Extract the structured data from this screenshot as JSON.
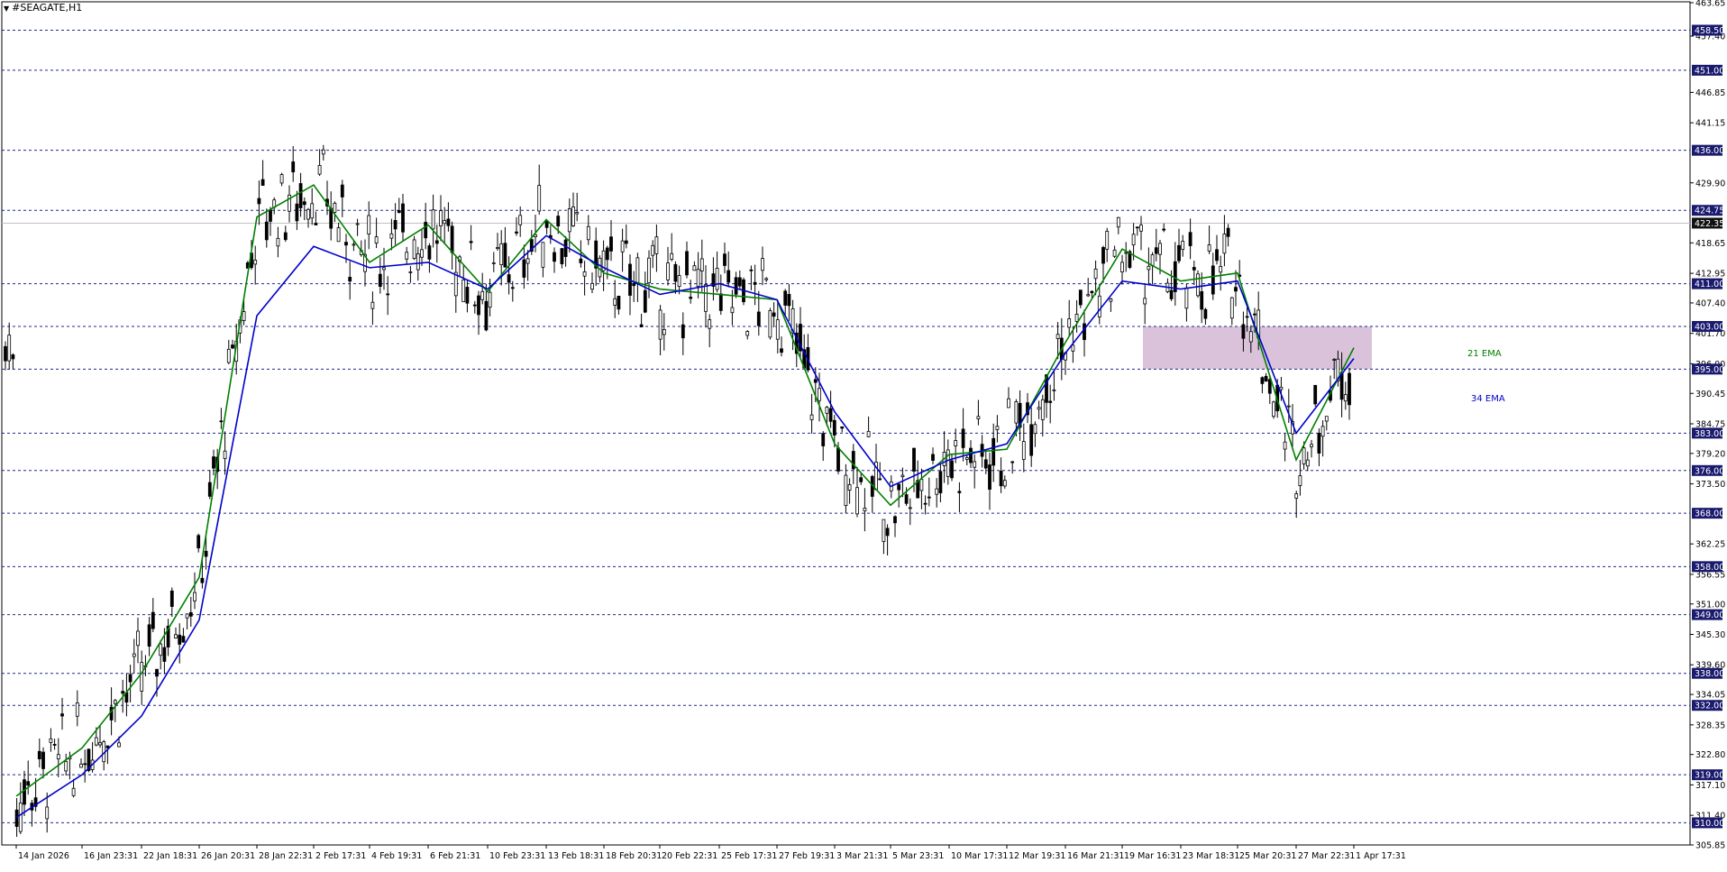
{
  "header": {
    "symbol_label": "#SEAGATE,H1"
  },
  "colors": {
    "background": "#ffffff",
    "candle": "#000000",
    "ema21": "#008000",
    "ema34": "#0000cc",
    "level_line": "#1f2a8c",
    "zone_fill": "#d8bfd8",
    "price_badge_bg": "#1a1a6e",
    "price_badge_text": "#ffffff",
    "current_price_line": "#c0c0c0"
  },
  "chart_data": {
    "type": "candlestick",
    "title": "",
    "xlabel": "",
    "ylabel": "",
    "ylim": [
      305.85,
      463.65
    ],
    "grid": false,
    "x_tick_labels": [
      "14 Jan 2026",
      "16 Jan 23:31",
      "22 Jan 18:31",
      "26 Jan 20:31",
      "28 Jan 22:31",
      "2 Feb 17:31",
      "4 Feb 19:31",
      "6 Feb 21:31",
      "10 Feb 23:31",
      "13 Feb 18:31",
      "18 Feb 20:31",
      "20 Feb 22:31",
      "25 Feb 17:31",
      "27 Feb 19:31",
      "3 Mar 21:31",
      "5 Mar 23:31",
      "10 Mar 17:31",
      "12 Mar 19:31",
      "16 Mar 21:31",
      "19 Mar 16:31",
      "23 Mar 18:31",
      "25 Mar 20:31",
      "27 Mar 22:31",
      "1 Apr 17:31"
    ],
    "y_tick_labels": [
      "463.65",
      "457.40",
      "446.85",
      "441.15",
      "429.90",
      "418.65",
      "412.95",
      "407.40",
      "401.70",
      "396.00",
      "390.45",
      "384.75",
      "379.20",
      "373.50",
      "362.25",
      "356.55",
      "351.00",
      "345.30",
      "339.60",
      "334.05",
      "328.35",
      "322.80",
      "317.10",
      "311.40",
      "305.85"
    ],
    "horizontal_levels": [
      458.5,
      451.0,
      436.0,
      424.75,
      411.0,
      403.0,
      395.0,
      383.0,
      376.0,
      368.0,
      358.0,
      349.0,
      338.0,
      332.0,
      319.0,
      310.0
    ],
    "current_price": 422.35,
    "zone": {
      "x_start": "22 Mar",
      "x_end": "1 Apr",
      "y_low": 395.0,
      "y_high": 403.0
    },
    "series": [
      {
        "name": "21 EMA",
        "x": [
          "14 Jan 2026",
          "16 Jan 23:31",
          "22 Jan 18:31",
          "26 Jan 20:31",
          "28 Jan 22:31",
          "2 Feb 17:31",
          "4 Feb 19:31",
          "6 Feb 21:31",
          "10 Feb 23:31",
          "13 Feb 18:31",
          "18 Feb 20:31",
          "20 Feb 22:31",
          "25 Feb 17:31",
          "27 Feb 19:31",
          "3 Mar 21:31",
          "5 Mar 23:31",
          "10 Mar 17:31",
          "12 Mar 19:31",
          "16 Mar 21:31",
          "19 Mar 16:31",
          "23 Mar 18:31",
          "25 Mar 20:31",
          "27 Mar 22:31",
          "1 Apr 17:31"
        ],
        "values": [
          315.0,
          324.0,
          338.0,
          356.0,
          423.5,
          429.5,
          415.0,
          422.0,
          409.5,
          423.0,
          413.0,
          410.0,
          409.0,
          408.0,
          381.0,
          369.5,
          379.0,
          380.0,
          400.0,
          417.5,
          411.5,
          413.0,
          378.0,
          399.0
        ]
      },
      {
        "name": "34 EMA",
        "x": [
          "14 Jan 2026",
          "16 Jan 23:31",
          "22 Jan 18:31",
          "26 Jan 20:31",
          "28 Jan 22:31",
          "2 Feb 17:31",
          "4 Feb 19:31",
          "6 Feb 21:31",
          "10 Feb 23:31",
          "13 Feb 18:31",
          "18 Feb 20:31",
          "20 Feb 22:31",
          "25 Feb 17:31",
          "27 Feb 19:31",
          "3 Mar 21:31",
          "5 Mar 23:31",
          "10 Mar 17:31",
          "12 Mar 19:31",
          "16 Mar 21:31",
          "19 Mar 16:31",
          "23 Mar 18:31",
          "25 Mar 20:31",
          "27 Mar 22:31",
          "1 Apr 17:31"
        ],
        "values": [
          311.0,
          319.0,
          330.0,
          348.0,
          405.0,
          418.0,
          414.0,
          415.0,
          410.0,
          420.0,
          414.0,
          409.0,
          411.0,
          408.0,
          387.0,
          373.0,
          378.0,
          381.0,
          398.0,
          411.5,
          410.0,
          411.5,
          383.0,
          397.0
        ]
      }
    ]
  },
  "annotations": {
    "ema21_label": "21 EMA",
    "ema34_label": "34 EMA"
  }
}
